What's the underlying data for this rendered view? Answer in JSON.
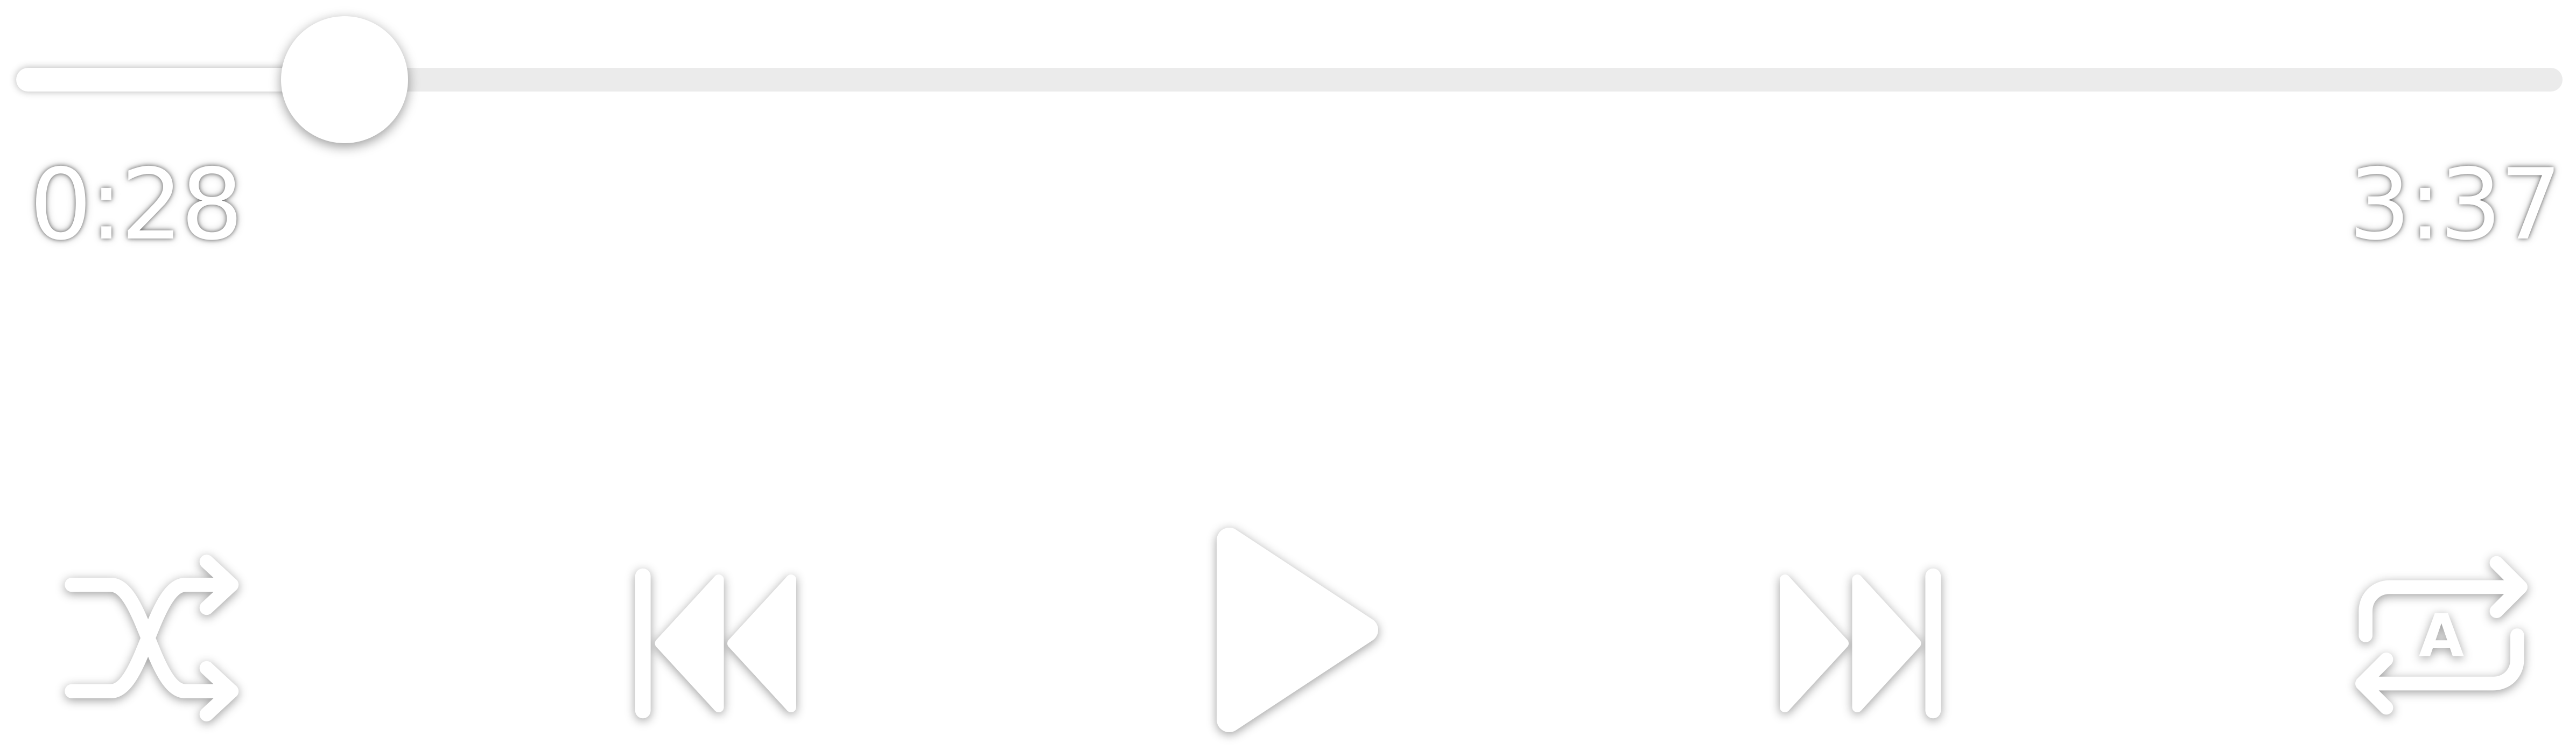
{
  "player": {
    "elapsed_time": "0:28",
    "total_time": "3:37",
    "progress": 0.129,
    "colors": {
      "icon": "#ffffff",
      "track": "#ebebeb",
      "track_fill": "#ffffff"
    },
    "controls": [
      {
        "id": "shuffle",
        "icon": "shuffle-icon"
      },
      {
        "id": "previous",
        "icon": "skip-previous-icon"
      },
      {
        "id": "play",
        "icon": "play-icon"
      },
      {
        "id": "next",
        "icon": "skip-next-icon"
      },
      {
        "id": "repeat",
        "icon": "repeat-icon",
        "badge": "A"
      }
    ]
  }
}
